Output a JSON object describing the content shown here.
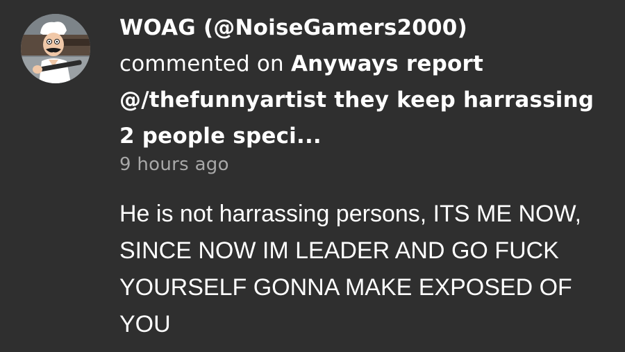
{
  "notification": {
    "username": "WOAG (@NoiseGamers2000)",
    "action_text": "commented on",
    "post_title": "Anyways report @/thefunnyartist they keep harrassing 2 people speci...",
    "timestamp": "9 hours ago",
    "comment_text": "He is not harrassing persons, ITS ME NOW, SINCE NOW IM LEADER AND GO FUCK YOURSELF GONNA MAKE EXPOSED OF YOU"
  },
  "colors": {
    "background": "#2f2f2f",
    "text": "#ffffff",
    "muted": "#a8a8a8"
  }
}
